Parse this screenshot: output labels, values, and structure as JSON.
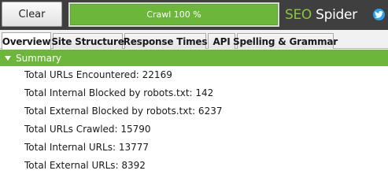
{
  "toolbar": {
    "clear_label": "Clear",
    "progress_text": "Crawl 100 %",
    "progress_value": 1.0
  },
  "brand": {
    "seo": "SEO",
    "spider": " Spider",
    "accent_color": "#6cb73b",
    "twitter_icon": "twitter-bird-icon"
  },
  "tabs": [
    {
      "label": "Overview",
      "active": true
    },
    {
      "label": "Site Structure",
      "active": false
    },
    {
      "label": "Response Times",
      "active": false
    },
    {
      "label": "API",
      "active": false
    },
    {
      "label": "Spelling & Grammar",
      "active": false
    }
  ],
  "summary": {
    "header": "Summary",
    "expanded": true,
    "rows": [
      "Total URLs Encountered: 22169",
      "Total Internal Blocked by robots.txt: 142",
      "Total External Blocked by robots.txt: 6237",
      "Total URLs Crawled: 15790",
      "Total Internal URLs: 13777",
      "Total External URLs: 8392"
    ]
  }
}
